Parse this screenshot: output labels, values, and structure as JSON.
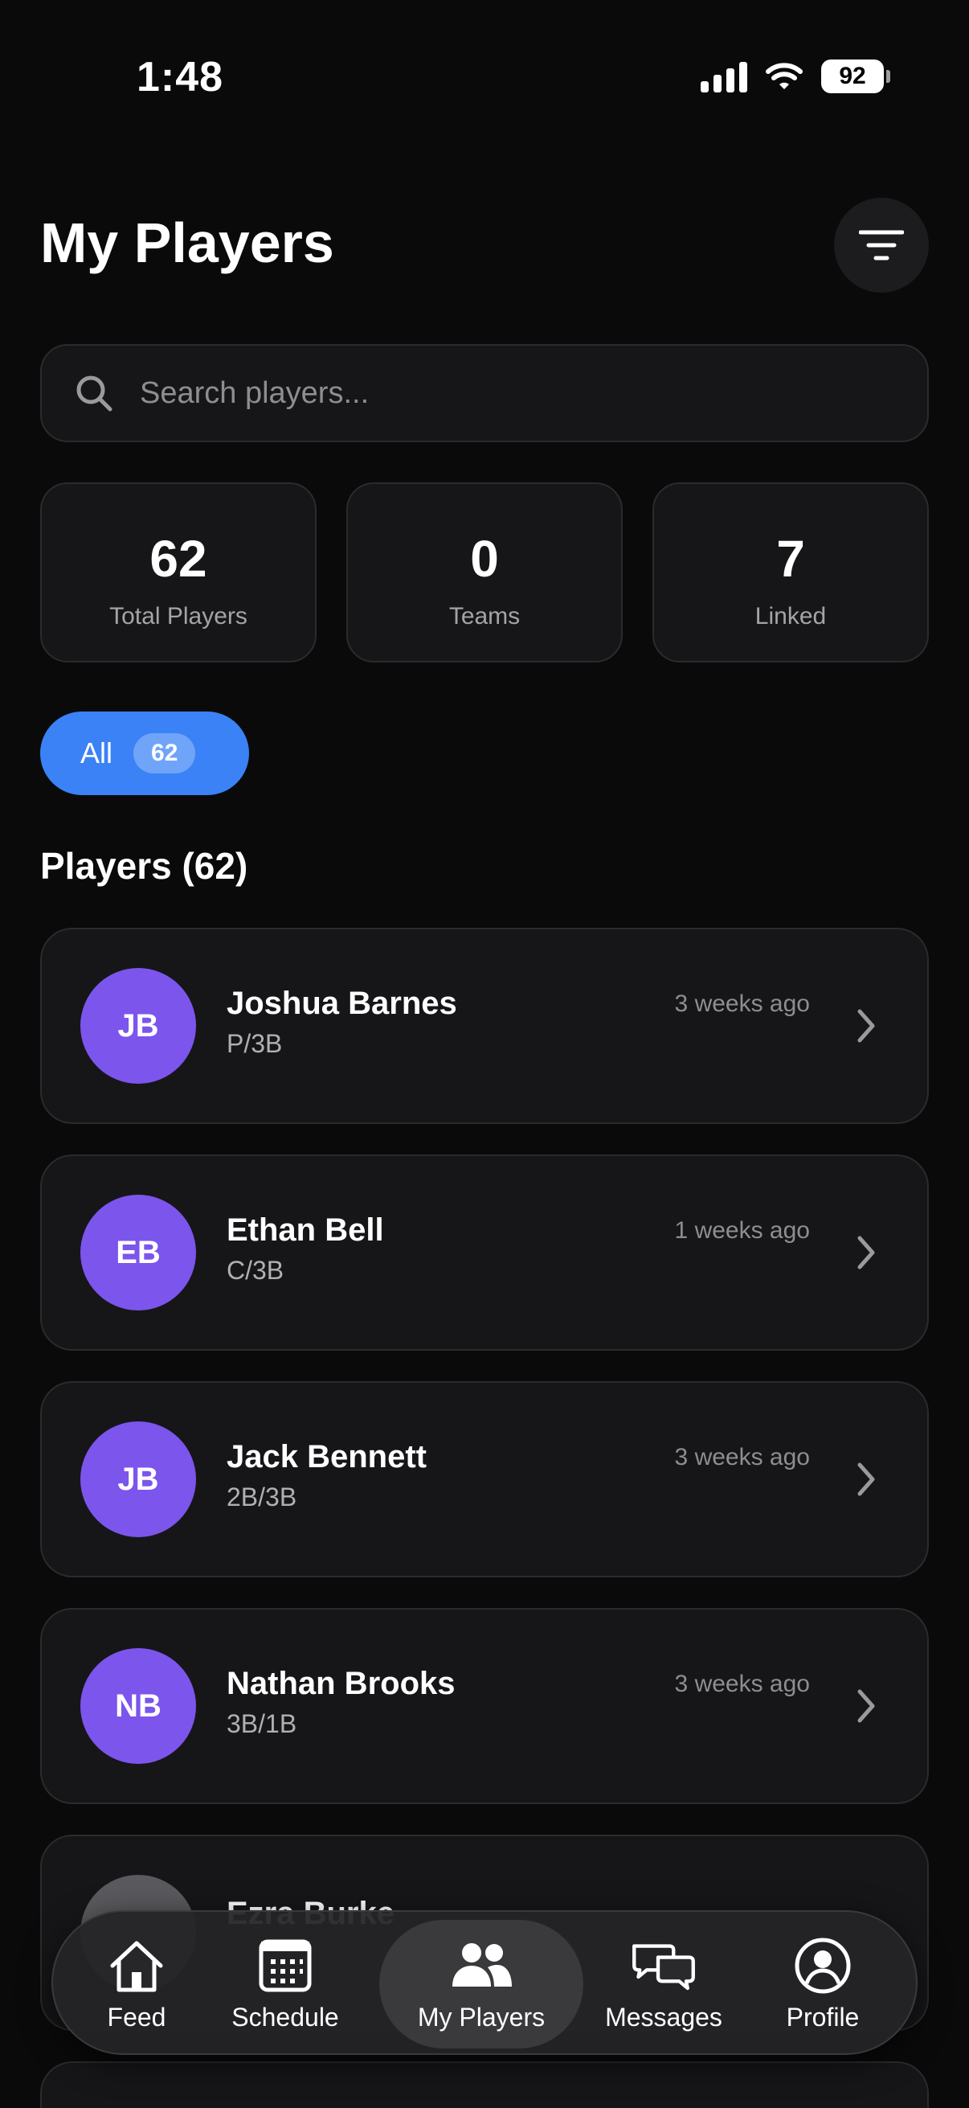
{
  "status": {
    "time": "1:48",
    "battery": "92"
  },
  "header": {
    "title": "My Players"
  },
  "search": {
    "placeholder": "Search players..."
  },
  "stats": [
    {
      "value": "62",
      "label": "Total Players"
    },
    {
      "value": "0",
      "label": "Teams"
    },
    {
      "value": "7",
      "label": "Linked"
    }
  ],
  "filter_chip": {
    "label": "All",
    "count": "62"
  },
  "section_title": "Players (62)",
  "players": [
    {
      "initials": "JB",
      "name": "Joshua Barnes",
      "position": "P/3B",
      "time": "3 weeks ago"
    },
    {
      "initials": "EB",
      "name": "Ethan Bell",
      "position": "C/3B",
      "time": "1 weeks ago"
    },
    {
      "initials": "JB",
      "name": "Jack Bennett",
      "position": "2B/3B",
      "time": "3 weeks ago"
    },
    {
      "initials": "NB",
      "name": "Nathan Brooks",
      "position": "3B/1B",
      "time": "3 weeks ago"
    },
    {
      "initials": "",
      "name": "Ezra Burke",
      "position": "",
      "time": ""
    }
  ],
  "tabs": [
    {
      "label": "Feed",
      "icon": "home-icon"
    },
    {
      "label": "Schedule",
      "icon": "calendar-icon"
    },
    {
      "label": "My Players",
      "icon": "people-icon",
      "active": true
    },
    {
      "label": "Messages",
      "icon": "chat-bubbles-icon"
    },
    {
      "label": "Profile",
      "icon": "profile-circle-icon"
    }
  ],
  "colors": {
    "accent": "#3a82f6",
    "avatar": "#7c55ec",
    "background": "#0a0a0b",
    "card": "#161618"
  }
}
